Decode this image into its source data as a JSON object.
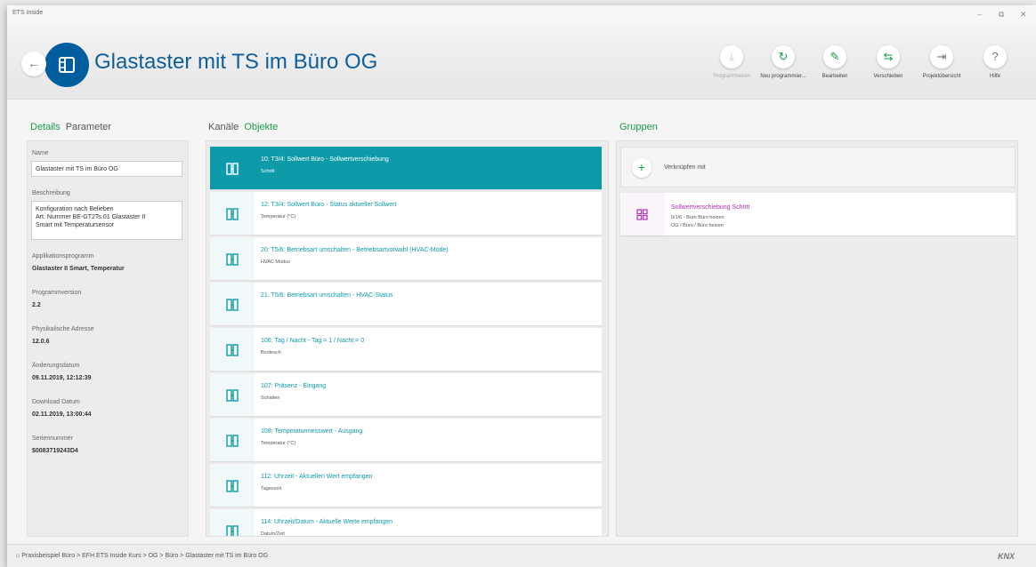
{
  "window": {
    "app_title": "ETS Inside",
    "minimize": "–",
    "restore": "⧉",
    "close": "✕"
  },
  "header": {
    "title": "Glastaster mit TS im Büro OG",
    "back_icon": "←"
  },
  "toolbar": [
    {
      "label": "Programmieren",
      "icon": "download-icon",
      "glyph": "⤓"
    },
    {
      "label": "Neu programmier...",
      "icon": "refresh-icon",
      "glyph": "↻"
    },
    {
      "label": "Bearbeiten",
      "icon": "pencil-icon",
      "glyph": "✎"
    },
    {
      "label": "Verschieben",
      "icon": "swap-icon",
      "glyph": "⇆"
    },
    {
      "label": "Projektübersicht",
      "icon": "exit-icon",
      "glyph": "⇥"
    },
    {
      "label": "Hilfe",
      "icon": "help-icon",
      "glyph": "?"
    }
  ],
  "left": {
    "tab_details": "Details",
    "tab_parameter": "Parameter",
    "name_label": "Name",
    "name_value": "Glastaster mit TS im Büro OG",
    "desc_label": "Beschreibung",
    "desc_lines": [
      "Konfiguration nach Belieben",
      "Art. Nummer BE-GT2Ts.01 Glastaster II",
      "Smart mit Temperatursensor"
    ],
    "app_label": "Applikationsprogramm",
    "app_value": "Glastaster II Smart, Temperatur",
    "ver_label": "Programmversion",
    "ver_value": "2.2",
    "addr_label": "Physikalische Adresse",
    "addr_value": "12.0.6",
    "change_label": "Änderungsdatum",
    "change_value": "09.11.2019, 12:12:39",
    "dl_label": "Download Datum",
    "dl_value": "02.11.2019, 13:00:44",
    "serial_label": "Seriennummer",
    "serial_value": "$0083719243D4"
  },
  "middle": {
    "tab_kanaele": "Kanäle",
    "tab_objekte": "Objekte",
    "objects": [
      {
        "title": "10: T3/4: Sollwert Büro - Sollwertverschiebung",
        "sub": "Schritt"
      },
      {
        "title": "12: T3/4: Sollwert Büro - Status aktueller Sollwert",
        "sub": "Temperatur (°C)"
      },
      {
        "title": "20: T5/6: Betriebsart umschalten - Betriebsartvorwahl (HVAC-Mode)",
        "sub": "HVAC Modus"
      },
      {
        "title": "21: T5/6: Betriebsart umschalten - HVAC-Status",
        "sub": ""
      },
      {
        "title": "106: Tag / Nacht - Tag = 1 / Nacht = 0",
        "sub": "Boolesch"
      },
      {
        "title": "107: Präsenz - Eingang",
        "sub": "Schalten"
      },
      {
        "title": "108: Temperaturmesswert - Ausgang",
        "sub": "Temperatur (°C)"
      },
      {
        "title": "112: Uhrzeit - Aktuellen Wert empfangen",
        "sub": "Tageszeit"
      },
      {
        "title": "114: Uhrzeit/Datum - Aktuelle Werte empfangen",
        "sub": "Datum/Zeit"
      }
    ]
  },
  "right": {
    "heading": "Gruppen",
    "link_text": "Verknüpfen mit",
    "group": {
      "title": "Sollwertverschiebung Schritt",
      "line1": "0/1/6 - Büro Büro heizen",
      "line2": "OG / Büro / Büro heizen"
    }
  },
  "footer": {
    "breadcrumb": "Praxisbeispiel Büro > EFH ETS Inside Kurs > OG > Büro > Glastaster mit TS im Büro OG",
    "logo": "KNX"
  }
}
